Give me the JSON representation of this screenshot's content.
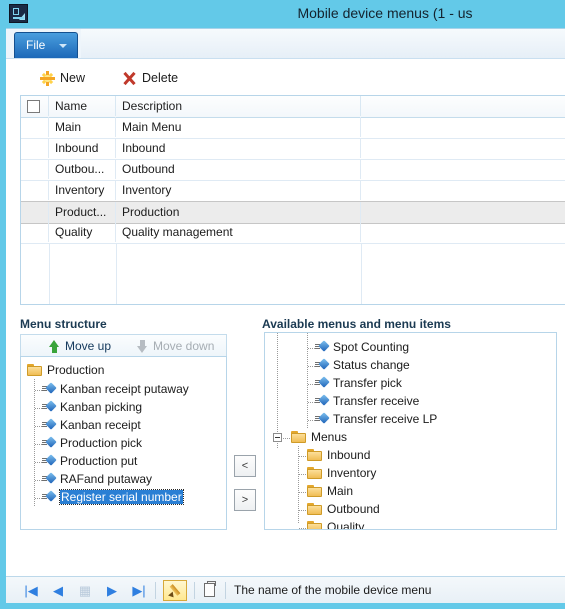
{
  "window": {
    "title": "Mobile device menus (1 - us",
    "icon": "app-chart-icon"
  },
  "ribbon": {
    "file_label": "File",
    "caret_icon": "chevron-down-icon"
  },
  "toolbar": {
    "new_label": "New",
    "new_icon": "star-new-icon",
    "delete_label": "Delete",
    "delete_icon": "red-x-icon"
  },
  "grid": {
    "columns": [
      "",
      "Name",
      "Description",
      ""
    ],
    "rows": [
      {
        "name": "Main",
        "description": "Main Menu",
        "selected": false
      },
      {
        "name": "Inbound",
        "description": "Inbound",
        "selected": false
      },
      {
        "name": "Outbou...",
        "description": "Outbound",
        "selected": false
      },
      {
        "name": "Inventory",
        "description": "Inventory",
        "selected": false
      },
      {
        "name": "Product...",
        "description": "Production",
        "selected": true
      },
      {
        "name": "Quality",
        "description": "Quality management",
        "selected": false
      }
    ]
  },
  "menu_structure": {
    "title": "Menu structure",
    "move_up_label": "Move up",
    "move_up_icon": "arrow-up-icon",
    "move_down_label": "Move down",
    "move_down_icon": "arrow-down-icon",
    "move_down_disabled": true,
    "tree": [
      {
        "label": "Production",
        "type": "folder",
        "level": 0,
        "selected": false
      },
      {
        "label": "Kanban receipt putaway",
        "type": "item",
        "level": 1,
        "selected": false
      },
      {
        "label": "Kanban picking",
        "type": "item",
        "level": 1,
        "selected": false
      },
      {
        "label": "Kanban receipt",
        "type": "item",
        "level": 1,
        "selected": false
      },
      {
        "label": "Production pick",
        "type": "item",
        "level": 1,
        "selected": false
      },
      {
        "label": "Production put",
        "type": "item",
        "level": 1,
        "selected": false
      },
      {
        "label": "RAFand putaway",
        "type": "item",
        "level": 1,
        "selected": false
      },
      {
        "label": "Register serial number",
        "type": "item",
        "level": 1,
        "selected": true
      }
    ]
  },
  "available": {
    "title": "Available menus and menu items",
    "tree": [
      {
        "label": "Spot Counting",
        "type": "item",
        "level": 1,
        "expander": false
      },
      {
        "label": "Status change",
        "type": "item",
        "level": 1,
        "expander": false
      },
      {
        "label": "Transfer pick",
        "type": "item",
        "level": 1,
        "expander": false
      },
      {
        "label": "Transfer receive",
        "type": "item",
        "level": 1,
        "expander": false
      },
      {
        "label": "Transfer receive LP",
        "type": "item",
        "level": 1,
        "expander": false
      },
      {
        "label": "Menus",
        "type": "folder",
        "level": 0,
        "expander": true
      },
      {
        "label": "Inbound",
        "type": "folder",
        "level": 1,
        "expander": false
      },
      {
        "label": "Inventory",
        "type": "folder",
        "level": 1,
        "expander": false
      },
      {
        "label": "Main",
        "type": "folder",
        "level": 1,
        "expander": false
      },
      {
        "label": "Outbound",
        "type": "folder",
        "level": 1,
        "expander": false
      },
      {
        "label": "Quality",
        "type": "folder",
        "level": 1,
        "expander": false
      }
    ]
  },
  "transfer": {
    "left_label": "<",
    "right_label": ">"
  },
  "statusbar": {
    "first_icon": "first-record-icon",
    "prev_icon": "previous-record-icon",
    "grid_icon": "grid-view-icon",
    "next_icon": "next-record-icon",
    "last_icon": "last-record-icon",
    "first_glyph": "|◀",
    "prev_glyph": "◀",
    "grid_glyph": "▦",
    "next_glyph": "▶",
    "last_glyph": "▶|",
    "edit_icon": "edit-pencil-icon",
    "doc_icon": "document-icon",
    "message": "The name of the mobile device menu"
  },
  "colors": {
    "titlebar": "#63c9e8",
    "accent_blue": "#2a7fd4",
    "selection": "#2a7fd4",
    "grid_row_selected": "#ececec"
  }
}
